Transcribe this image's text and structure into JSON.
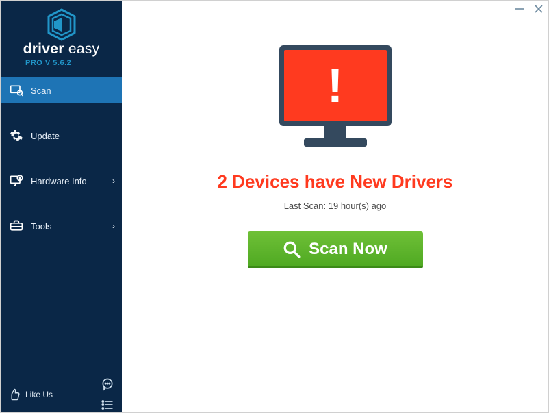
{
  "brand": {
    "name_bold": "driver",
    "name_rest": " easy",
    "version": "PRO V 5.6.2"
  },
  "sidebar": {
    "items": [
      {
        "label": "Scan"
      },
      {
        "label": "Update"
      },
      {
        "label": "Hardware Info"
      },
      {
        "label": "Tools"
      }
    ],
    "like_label": "Like Us"
  },
  "main": {
    "headline": "2 Devices have New Drivers",
    "last_scan": "Last Scan: 19 hour(s) ago",
    "scan_button": "Scan Now"
  },
  "colors": {
    "accent": "#1e74b5",
    "alert": "#ff3a1f",
    "scan_green": "#5db52b",
    "sidebar_bg": "#0a2747"
  }
}
